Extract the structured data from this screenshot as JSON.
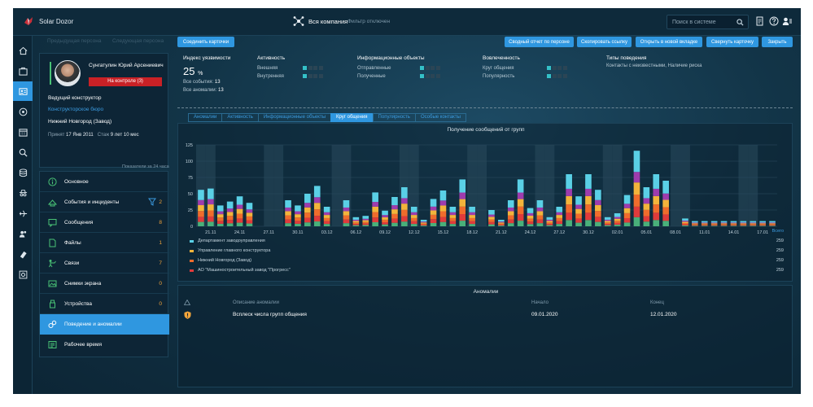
{
  "header": {
    "app_title": "Solar Dozor",
    "company": "Вся компания",
    "filter_status": "Фильтр отключен",
    "search_placeholder": "Поиск в системе"
  },
  "toolbar": {
    "merge_label": "Соединить карточки",
    "ghost_tabs": [
      "Предыдущая персона",
      "Следующая персона"
    ],
    "actions": [
      "Сводный отчет по персоне",
      "Скопировать ссылку",
      "Открыть в новой вкладке",
      "Свернуть карточку",
      "Закрыть"
    ]
  },
  "profile": {
    "name": "Сунгатулин Юрий Арсениевич",
    "badge": "На контроле (3)",
    "position": "Ведущий конструктор",
    "department": "Конструкторское бюро",
    "location": "Нижний Новгород (Завод)",
    "hired_label": "Принят",
    "hired_date": "17 Янв 2011",
    "tenure_label": "Стаж",
    "tenure": "9 лет 10 мес"
  },
  "period_note": "Показатели за 24 часа",
  "categories": [
    {
      "label": "Основное",
      "count": "",
      "icon": "info-icon"
    },
    {
      "label": "События и инциденты",
      "count": "2",
      "icon": "events-icon"
    },
    {
      "label": "Сообщения",
      "count": "8",
      "icon": "message-icon"
    },
    {
      "label": "Файлы",
      "count": "1",
      "icon": "file-icon"
    },
    {
      "label": "Связи",
      "count": "7",
      "icon": "links-icon"
    },
    {
      "label": "Снимки экрана",
      "count": "0",
      "icon": "screenshot-icon"
    },
    {
      "label": "Устройства",
      "count": "0",
      "icon": "usb-icon"
    },
    {
      "label": "Поведение и аномалии",
      "count": "",
      "icon": "behavior-icon"
    },
    {
      "label": "Рабочее время",
      "count": "",
      "icon": "worktime-icon"
    }
  ],
  "summary": {
    "vulnerability": {
      "title": "Индекс уязвимости",
      "value": "25",
      "unit": "%",
      "events_label": "Все события:",
      "events": "13",
      "anomalies_label": "Все аномалии:",
      "anomalies": "13"
    },
    "activity": {
      "title": "Активность",
      "rows": [
        {
          "label": "Внешняя",
          "level": 1
        },
        {
          "label": "Внутренняя",
          "level": 1
        }
      ]
    },
    "info_objects": {
      "title": "Информационные объекты",
      "rows": [
        {
          "label": "Отправленные",
          "level": 1
        },
        {
          "label": "Полученные",
          "level": 1
        }
      ]
    },
    "engagement": {
      "title": "Вовлеченность",
      "rows": [
        {
          "label": "Круг общения",
          "level": 1
        },
        {
          "label": "Популярность",
          "level": 1
        }
      ]
    },
    "behavior_types": {
      "title": "Типы поведения",
      "value": "Контакты с неизвестными, Наличие риска"
    }
  },
  "tabs": [
    "Аномалии",
    "Активность",
    "Информационные объекты",
    "Круг общения",
    "Популярность",
    "Особые контакты"
  ],
  "active_tab": 3,
  "chart_data": {
    "type": "bar",
    "title": "Получение сообщений от групп",
    "ylim": [
      0,
      125
    ],
    "yticks": [
      0,
      25,
      50,
      75,
      100,
      125
    ],
    "x": [
      "20.11",
      "21.11",
      "22.11",
      "23.11",
      "24.11",
      "25.11",
      "26.11",
      "27.11",
      "28.11",
      "29.11",
      "30.11",
      "01.12",
      "02.12",
      "03.12",
      "04.12",
      "05.12",
      "06.12",
      "07.12",
      "08.12",
      "09.12",
      "10.12",
      "11.12",
      "12.12",
      "13.12",
      "14.12",
      "15.12",
      "16.12",
      "17.12",
      "18.12",
      "19.12",
      "20.12",
      "21.12",
      "22.12",
      "23.12",
      "24.12",
      "25.12",
      "26.12",
      "27.12",
      "28.12",
      "29.12",
      "30.12",
      "31.12",
      "01.01",
      "02.01",
      "03.01",
      "04.01",
      "05.01",
      "06.01",
      "07.01",
      "08.01",
      "09.01",
      "10.01",
      "11.01",
      "12.01",
      "13.01",
      "14.01",
      "15.01",
      "16.01",
      "17.01",
      "18.01"
    ],
    "x_tick_labels": [
      "21.11",
      "24.11",
      "27.11",
      "30.11",
      "03.12",
      "06.12",
      "09.12",
      "12.12",
      "15.12",
      "18.12",
      "21.12",
      "24.12",
      "27.12",
      "30.12",
      "02.01",
      "05.01",
      "08.01",
      "11.01",
      "14.01",
      "17.01"
    ],
    "totals": [
      56,
      58,
      32,
      38,
      46,
      36,
      0,
      0,
      0,
      40,
      32,
      50,
      62,
      30,
      0,
      40,
      14,
      16,
      52,
      24,
      45,
      60,
      30,
      10,
      42,
      55,
      30,
      72,
      30,
      0,
      25,
      10,
      40,
      72,
      28,
      40,
      14,
      30,
      80,
      46,
      80,
      56,
      14,
      20,
      48,
      116,
      60,
      80,
      70,
      0,
      12,
      8,
      8,
      8,
      8,
      8,
      8,
      8,
      8,
      8
    ],
    "series": [
      {
        "name": "Департамент заводоуправления",
        "total": "259",
        "color": "#5ad0e6"
      },
      {
        "name": "Управление главного конструктора",
        "total": "259",
        "color": "#9e3cad"
      },
      {
        "name": "Нижний Новгород (Завод)",
        "total": "259",
        "color": "#f06c2c"
      },
      {
        "name": "АО \"Машиностроительный завод \"Прогресс\"",
        "total": "259",
        "color": "#e03b3b"
      }
    ],
    "total_label": "Всего",
    "weekend_bands": true,
    "grid": true
  },
  "anomalies": {
    "title": "Аномалии",
    "columns": [
      "Описание аномалии",
      "Начало",
      "Конец"
    ],
    "rows": [
      {
        "description": "Всплеск числа групп общения",
        "start": "09.01.2020",
        "end": "12.01.2020"
      }
    ]
  },
  "colors": {
    "accent": "#2f97e0",
    "danger": "#c92126",
    "count": "#f3a53b",
    "good": "#49c275"
  }
}
